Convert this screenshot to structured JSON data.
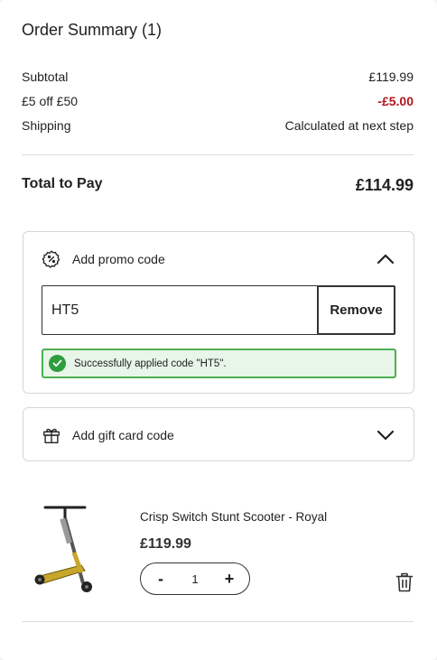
{
  "summary": {
    "title": "Order Summary (1)",
    "rows": [
      {
        "label": "Subtotal",
        "value": "£119.99"
      },
      {
        "label": "£5 off £50",
        "value": "-£5.00"
      },
      {
        "label": "Shipping",
        "value": "Calculated at next step"
      }
    ],
    "total_label": "Total to Pay",
    "total_value": "£114.99"
  },
  "promo": {
    "label": "Add promo code",
    "icon": "percent-badge-icon",
    "input_value": "HT5",
    "remove_label": "Remove",
    "success_message": "Successfully applied code \"HT5\".",
    "expanded": true
  },
  "gift": {
    "label": "Add gift card code",
    "icon": "gift-icon",
    "expanded": false
  },
  "item": {
    "name": "Crisp Switch Stunt Scooter - Royal",
    "price": "£119.99",
    "quantity": "1",
    "minus_label": "-",
    "plus_label": "+"
  },
  "colors": {
    "discount": "#b3151d",
    "success_border": "#4caf50",
    "success_bg": "#e8f5e9"
  }
}
